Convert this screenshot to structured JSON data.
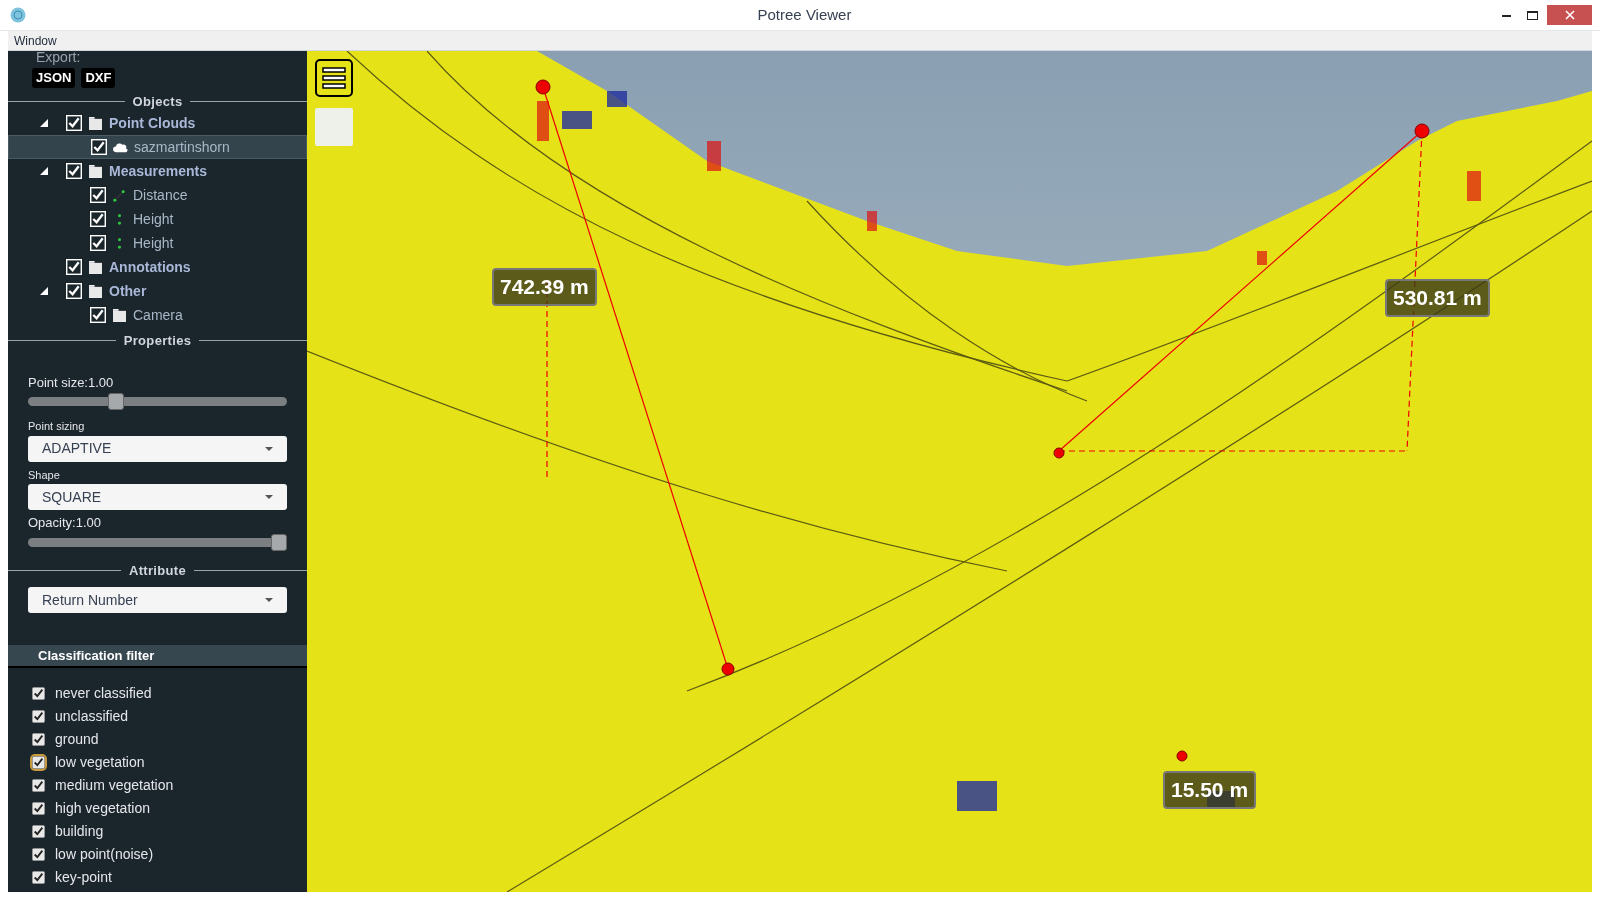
{
  "window": {
    "title": "Potree Viewer"
  },
  "menu": [
    "Window"
  ],
  "export": {
    "label": "Export:",
    "formats": [
      "JSON",
      "DXF"
    ]
  },
  "objects": {
    "title": "Objects",
    "tree": [
      {
        "label": "Point Clouds",
        "kind": "folder",
        "checked": true,
        "expanded": true,
        "selected": false,
        "children": [
          {
            "label": "sazmartinshorn",
            "kind": "pointcloud",
            "checked": true,
            "selected": true
          }
        ]
      },
      {
        "label": "Measurements",
        "kind": "folder",
        "checked": true,
        "expanded": true,
        "selected": false,
        "children": [
          {
            "label": "Distance",
            "kind": "distance",
            "checked": true,
            "selected": false
          },
          {
            "label": "Height",
            "kind": "height",
            "checked": true,
            "selected": false
          },
          {
            "label": "Height",
            "kind": "height",
            "checked": true,
            "selected": false
          }
        ]
      },
      {
        "label": "Annotations",
        "kind": "folder",
        "checked": true,
        "selected": false
      },
      {
        "label": "Other",
        "kind": "folder",
        "checked": true,
        "expanded": true,
        "selected": false,
        "children": [
          {
            "label": "Camera",
            "kind": "folder",
            "checked": true,
            "selected": false
          }
        ]
      }
    ]
  },
  "properties": {
    "title": "Properties",
    "point_size": {
      "label": "Point size:1.00",
      "level": 0.33
    },
    "point_sizing": {
      "label": "Point sizing",
      "value": "ADAPTIVE"
    },
    "shape": {
      "label": "Shape",
      "value": "SQUARE"
    },
    "opacity": {
      "label": "Opacity:1.00",
      "level": 1.0
    }
  },
  "attribute": {
    "title": "Attribute",
    "value": "Return Number"
  },
  "classification_filter": {
    "title": "Classification filter",
    "items": [
      {
        "label": "never classified",
        "checked": true,
        "focused": false
      },
      {
        "label": "unclassified",
        "checked": true,
        "focused": false
      },
      {
        "label": "ground",
        "checked": true,
        "focused": false
      },
      {
        "label": "low vegetation",
        "checked": true,
        "focused": true
      },
      {
        "label": "medium vegetation",
        "checked": true,
        "focused": false
      },
      {
        "label": "high vegetation",
        "checked": true,
        "focused": false
      },
      {
        "label": "building",
        "checked": true,
        "focused": false
      },
      {
        "label": "low point(noise)",
        "checked": true,
        "focused": false
      },
      {
        "label": "key-point",
        "checked": true,
        "focused": false
      }
    ]
  },
  "viewport": {
    "measurement_labels": [
      "742.39 m",
      "530.81 m",
      "15.50 m"
    ]
  }
}
